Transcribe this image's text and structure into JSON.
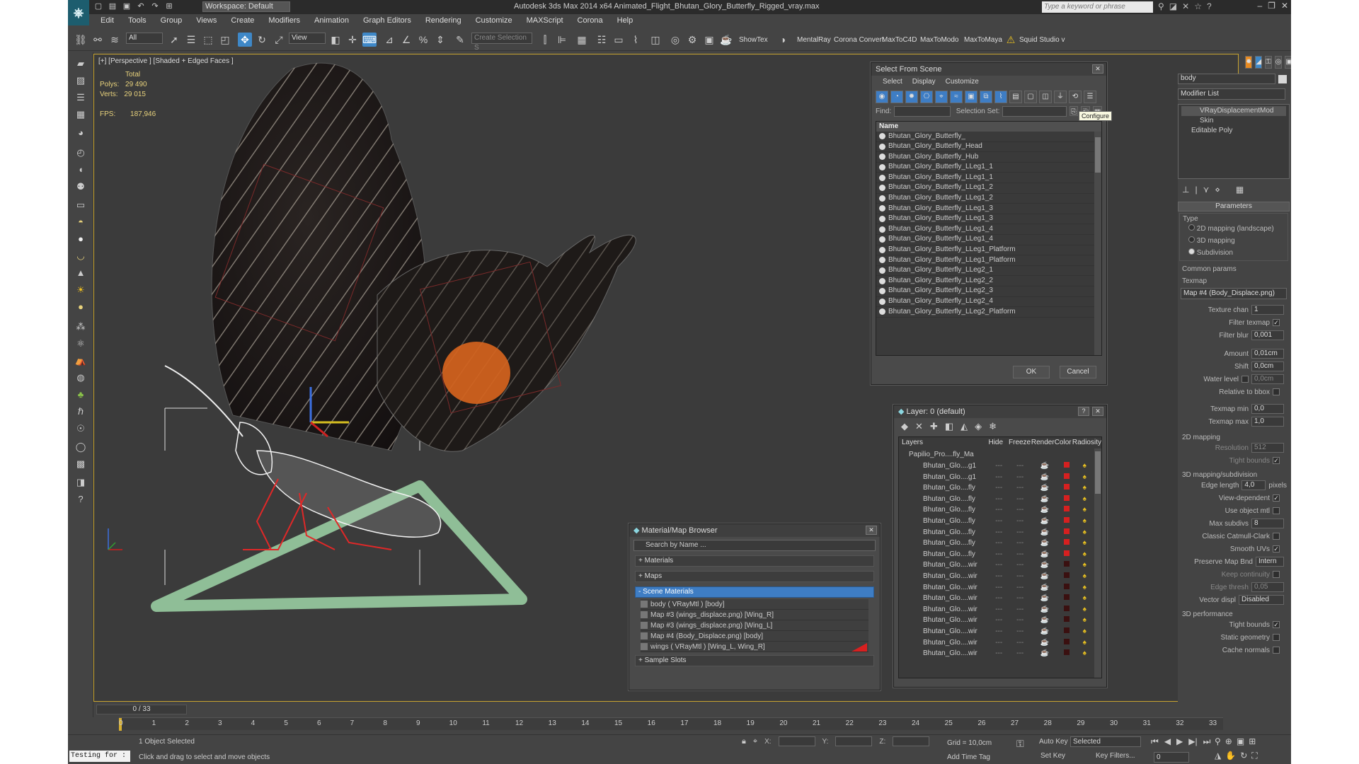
{
  "app": {
    "workspace": "Workspace: Default",
    "title": "Autodesk 3ds Max  2014 x64    Animated_Flight_Bhutan_Glory_Butterfly_Rigged_vray.max",
    "keyword_placeholder": "Type a keyword or phrase"
  },
  "menu": [
    "Edit",
    "Tools",
    "Group",
    "Views",
    "Create",
    "Modifiers",
    "Animation",
    "Graph Editors",
    "Rendering",
    "Customize",
    "MAXScript",
    "Corona",
    "Help"
  ],
  "toolbar": {
    "filter_value": "All",
    "refcoord_value": "View",
    "selection_set_placeholder": "Create Selection S",
    "plugins": [
      "ShowTex",
      "MentalRay",
      "Corona Convert",
      "MaxToC4D",
      "MaxToModo",
      "MaxToMaya",
      "Squid Studio v"
    ]
  },
  "viewport": {
    "label": "[+] [Perspective ] [Shaded + Edged Faces ]",
    "stats": {
      "total_label": "Total",
      "polys_label": "Polys:",
      "polys_value": "29 490",
      "verts_label": "Verts:",
      "verts_value": "29 015",
      "fps_label": "FPS:",
      "fps_value": "187,946"
    }
  },
  "select_from_scene": {
    "title": "Select From Scene",
    "menu": [
      "Select",
      "Display",
      "Customize"
    ],
    "find_label": "Find:",
    "selection_set_label": "Selection Set:",
    "tooltip": "Configure",
    "column_name": "Name",
    "items": [
      "Bhutan_Glory_Butterfly_",
      "Bhutan_Glory_Butterfly_Head",
      "Bhutan_Glory_Butterfly_Hub",
      "Bhutan_Glory_Butterfly_LLeg1_1",
      "Bhutan_Glory_Butterfly_LLeg1_1",
      "Bhutan_Glory_Butterfly_LLeg1_2",
      "Bhutan_Glory_Butterfly_LLeg1_2",
      "Bhutan_Glory_Butterfly_LLeg1_3",
      "Bhutan_Glory_Butterfly_LLeg1_3",
      "Bhutan_Glory_Butterfly_LLeg1_4",
      "Bhutan_Glory_Butterfly_LLeg1_4",
      "Bhutan_Glory_Butterfly_LLeg1_Platform",
      "Bhutan_Glory_Butterfly_LLeg1_Platform",
      "Bhutan_Glory_Butterfly_LLeg2_1",
      "Bhutan_Glory_Butterfly_LLeg2_2",
      "Bhutan_Glory_Butterfly_LLeg2_3",
      "Bhutan_Glory_Butterfly_LLeg2_4",
      "Bhutan_Glory_Butterfly_LLeg2_Platform"
    ],
    "ok_label": "OK",
    "cancel_label": "Cancel"
  },
  "layer_dialog": {
    "title": "Layer: 0 (default)",
    "columns": [
      "Layers",
      "Hide",
      "Freeze",
      "Render",
      "Color",
      "Radiosity"
    ],
    "root": "Papilio_Pro....fly_Ma",
    "rows": [
      {
        "name": "Bhutan_Glo....g1",
        "color": "#d62020"
      },
      {
        "name": "Bhutan_Glo....g1",
        "color": "#d62020"
      },
      {
        "name": "Bhutan_Glo....fly",
        "color": "#d62020"
      },
      {
        "name": "Bhutan_Glo....fly",
        "color": "#d62020"
      },
      {
        "name": "Bhutan_Glo....fly",
        "color": "#d62020"
      },
      {
        "name": "Bhutan_Glo....fly",
        "color": "#d62020"
      },
      {
        "name": "Bhutan_Glo....fly",
        "color": "#d62020"
      },
      {
        "name": "Bhutan_Glo....fly",
        "color": "#d62020"
      },
      {
        "name": "Bhutan_Glo....fly",
        "color": "#d62020"
      },
      {
        "name": "Bhutan_Glo....wir",
        "color": "#3a1010"
      },
      {
        "name": "Bhutan_Glo....wir",
        "color": "#3a1010"
      },
      {
        "name": "Bhutan_Glo....wir",
        "color": "#3a1010"
      },
      {
        "name": "Bhutan_Glo....wir",
        "color": "#3a1010"
      },
      {
        "name": "Bhutan_Glo....wir",
        "color": "#3a1010"
      },
      {
        "name": "Bhutan_Glo....wir",
        "color": "#3a1010"
      },
      {
        "name": "Bhutan_Glo....wir",
        "color": "#3a1010"
      },
      {
        "name": "Bhutan_Glo....wir",
        "color": "#3a1010"
      },
      {
        "name": "Bhutan_Glo....wir",
        "color": "#3a1010"
      }
    ]
  },
  "material_browser": {
    "title": "Material/Map Browser",
    "search_placeholder": "Search by Name ...",
    "sections": [
      "+ Materials",
      "+ Maps",
      "- Scene Materials",
      "+ Sample Slots"
    ],
    "scene_materials": [
      "body  ( VRayMtl ) [body]",
      "Map #3 (wings_displace.png) [Wing_R]",
      "Map #3 (wings_displace.png) [Wing_L]",
      "Map #4 (Body_Displace.png) [body]",
      "wings  ( VRayMtl ) [Wing_L, Wing_R]"
    ]
  },
  "command_panel": {
    "object_name": "body",
    "modifier_list": "Modifier List",
    "stack": [
      "VRayDisplacementMod",
      "Skin",
      "Editable Poly"
    ],
    "rollout_title": "Parameters",
    "type_label": "Type",
    "type_options": [
      "2D mapping (landscape)",
      "3D mapping",
      "Subdivision"
    ],
    "common_params": "Common params",
    "texmap_label": "Texmap",
    "texmap_value": "Map #4 (Body_Displace.png)",
    "texture_chan_label": "Texture chan",
    "texture_chan_value": "1",
    "filter_texmap_label": "Filter texmap",
    "filter_blur_label": "Filter blur",
    "filter_blur_value": "0,001",
    "amount_label": "Amount",
    "amount_value": "0,01cm",
    "shift_label": "Shift",
    "shift_value": "0,0cm",
    "water_level_label": "Water level",
    "water_level_value": "0,0cm",
    "relative_bbox_label": "Relative to bbox",
    "texmap_min_label": "Texmap min",
    "texmap_min_value": "0,0",
    "texmap_max_label": "Texmap max",
    "texmap_max_value": "1,0",
    "mapping2d_label": "2D mapping",
    "resolution_label": "Resolution",
    "resolution_value": "512",
    "tight_bounds_label": "Tight bounds",
    "mapping3d_label": "3D mapping/subdivision",
    "edge_length_label": "Edge length",
    "edge_length_value": "4,0",
    "pixels_label": "pixels",
    "view_dependent_label": "View-dependent",
    "use_object_mtl_label": "Use object mtl",
    "max_subdivs_label": "Max subdivs",
    "max_subdivs_value": "8",
    "catmull_label": "Classic Catmull-Clark",
    "smooth_uvs_label": "Smooth UVs",
    "preserve_label": "Preserve Map Bnd",
    "preserve_value": "Intern",
    "keep_continuity_label": "Keep continuity",
    "edge_thresh_label": "Edge thresh",
    "edge_thresh_value": "0,05",
    "vector_displ_label": "Vector displ",
    "vector_displ_value": "Disabled",
    "perf_label": "3D performance",
    "perf_tight_bounds": "Tight bounds",
    "static_geometry_label": "Static geometry",
    "cache_normals_label": "Cache normals"
  },
  "timeline": {
    "frame_label": "0 / 33",
    "ticks": [
      "0",
      "1",
      "2",
      "3",
      "4",
      "5",
      "6",
      "7",
      "8",
      "9",
      "10",
      "11",
      "12",
      "13",
      "14",
      "15",
      "16",
      "17",
      "18",
      "19",
      "20",
      "21",
      "22",
      "23",
      "24",
      "25",
      "26",
      "27",
      "28",
      "29",
      "30",
      "31",
      "32",
      "33"
    ]
  },
  "status": {
    "script_listener": "Testing for :",
    "selection": "1 Object Selected",
    "prompt": "Click and drag to select and move objects",
    "x_label": "X:",
    "y_label": "Y:",
    "z_label": "Z:",
    "grid": "Grid = 10,0cm",
    "auto_key": "Auto Key",
    "selected": "Selected",
    "set_key": "Set Key",
    "key_filters": "Key Filters...",
    "add_time_tag": "Add Time Tag",
    "frame_value": "0"
  },
  "colors": {
    "viewport_border": "#c8a430",
    "selection_highlight": "#3e7dc4",
    "accent_blue": "#3e88c8"
  }
}
